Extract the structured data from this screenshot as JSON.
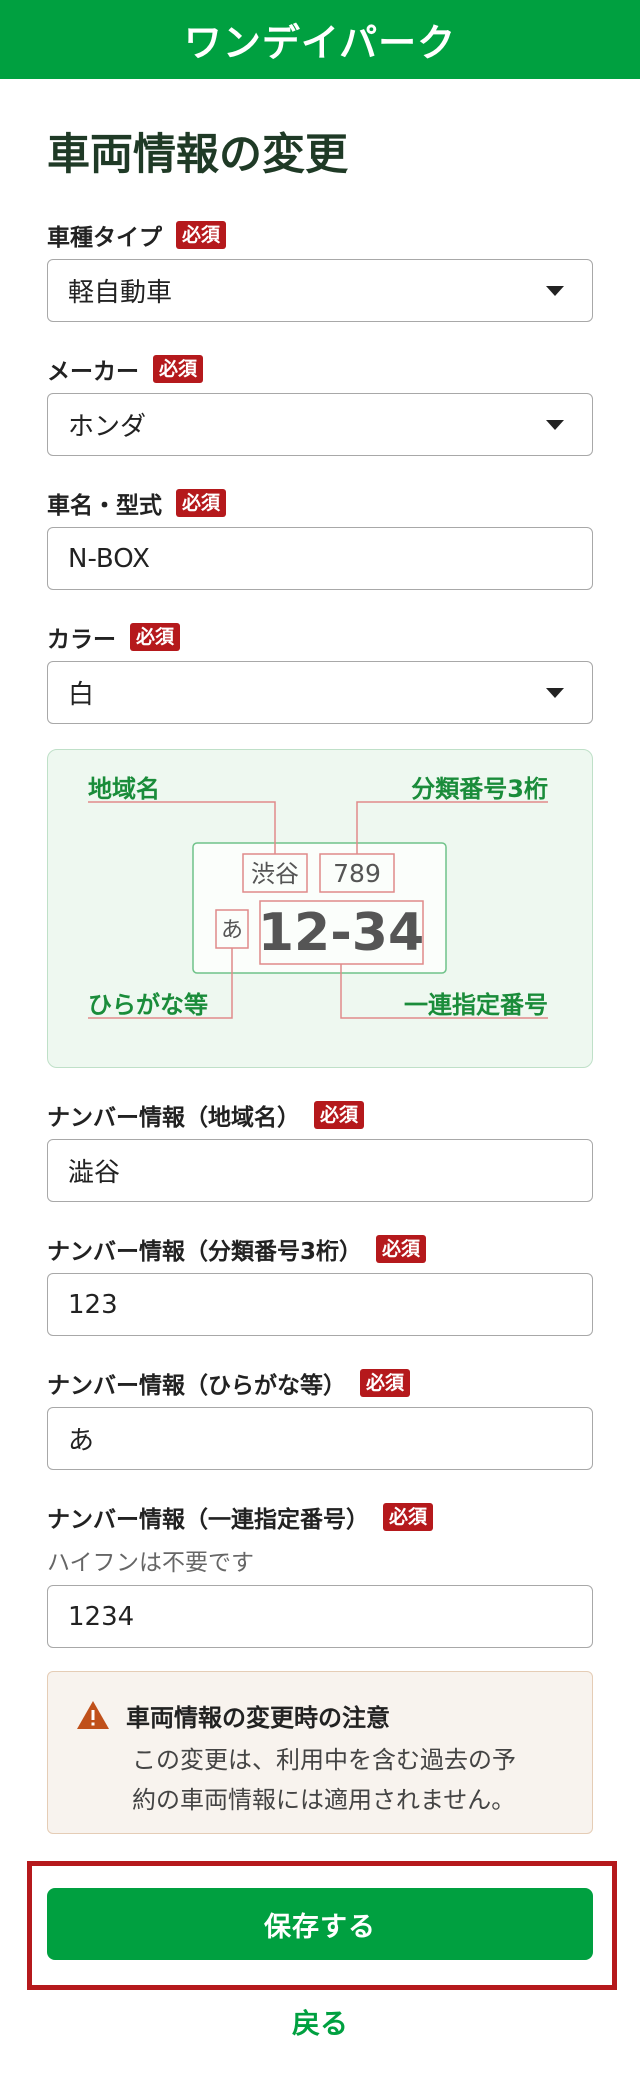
{
  "header": {
    "logo": "ワンデイパーク"
  },
  "page": {
    "title": "車両情報の変更"
  },
  "required_badge": "必須",
  "fields": {
    "car_type": {
      "label": "車種タイプ",
      "value": "軽自動車"
    },
    "maker": {
      "label": "メーカー",
      "value": "ホンダ"
    },
    "model": {
      "label": "車名・型式",
      "value": "N-BOX"
    },
    "color": {
      "label": "カラー",
      "value": "白"
    },
    "plate_region": {
      "label": "ナンバー情報（地域名）",
      "value": "澁谷"
    },
    "plate_class": {
      "label": "ナンバー情報（分類番号3桁）",
      "value": "123"
    },
    "plate_kana": {
      "label": "ナンバー情報（ひらがな等）",
      "value": "あ"
    },
    "plate_serial": {
      "label": "ナンバー情報（一連指定番号）",
      "hint": "ハイフンは不要です",
      "value": "1234"
    }
  },
  "plate_diagram": {
    "label_region": "地域名",
    "label_class": "分類番号3桁",
    "label_kana": "ひらがな等",
    "label_serial": "一連指定番号",
    "sample_region": "渋谷",
    "sample_class": "789",
    "sample_kana": "あ",
    "sample_serial": "12-34"
  },
  "notice": {
    "title": "車両情報の変更時の注意",
    "line1": "この変更は、利用中を含む過去の予",
    "line2": "約の車両情報には適用されません。"
  },
  "actions": {
    "save": "保存する",
    "back": "戻る"
  },
  "colors": {
    "brand_green": "#00a040",
    "badge_red": "#b5191c",
    "warning_orange": "#c0501a"
  }
}
